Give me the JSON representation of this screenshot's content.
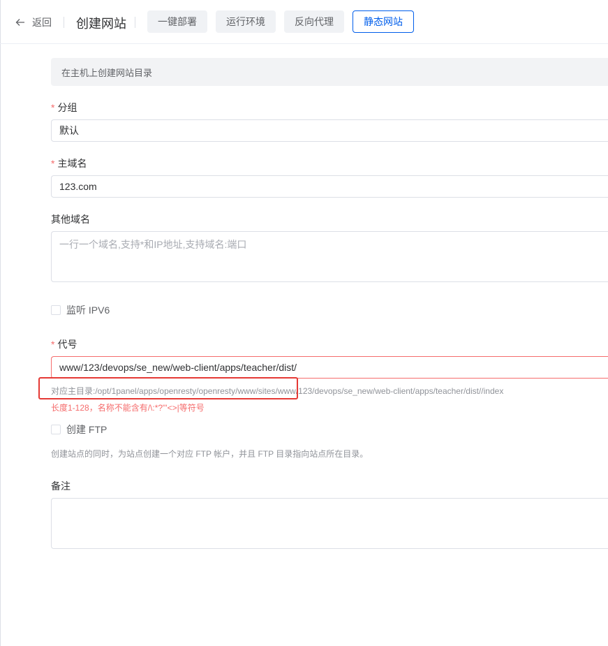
{
  "header": {
    "back_label": "返回",
    "title": "创建网站",
    "tabs": [
      {
        "label": "一键部署",
        "active": false
      },
      {
        "label": "运行环境",
        "active": false
      },
      {
        "label": "反向代理",
        "active": false
      },
      {
        "label": "静态网站",
        "active": true
      }
    ]
  },
  "form": {
    "info_text": "在主机上创建网站目录",
    "group": {
      "label": "分组",
      "required": true,
      "value": "默认"
    },
    "primary_domain": {
      "label": "主域名",
      "required": true,
      "value": "123.com"
    },
    "other_domains": {
      "label": "其他域名",
      "placeholder": "一行一个域名,支持*和IP地址,支持域名:端口"
    },
    "ipv6": {
      "label": "监听 IPV6",
      "checked": false
    },
    "alias": {
      "label": "代号",
      "required": true,
      "value": "www/123/devops/se_new/web-client/apps/teacher/dist/",
      "path_hint": "对应主目录:/opt/1panel/apps/openresty/openresty/www/sites/www/123/devops/se_new/web-client/apps/teacher/dist//index",
      "error": "长度1-128，名称不能含有/\\:*?\"'<>|等符号"
    },
    "ftp": {
      "label": "创建 FTP",
      "checked": false,
      "hint": "创建站点的同时，为站点创建一个对应 FTP 帐户，并且 FTP 目录指向站点所在目录。"
    },
    "remark": {
      "label": "备注",
      "value": ""
    }
  },
  "colors": {
    "accent": "#005eeb",
    "error": "#f56c6c",
    "annotation": "#e53935"
  }
}
